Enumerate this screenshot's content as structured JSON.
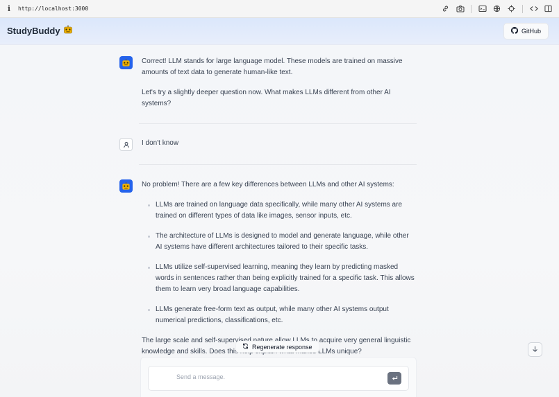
{
  "browser": {
    "info_icon": "i",
    "url": "http://localhost:3000",
    "toolbar_icons": [
      "link-icon",
      "camera-icon",
      "terminal-icon",
      "globe-icon",
      "crosshair-icon",
      "code-icon",
      "sidebar-icon"
    ]
  },
  "header": {
    "brand": "StudyBuddy",
    "brand_icon": "robot-emoji",
    "github_label": "GitHub"
  },
  "messages": [
    {
      "role": "assistant",
      "paragraphs": [
        "Correct! LLM stands for large language model. These models are trained on massive amounts of text data to generate human-like text.",
        "Let's try a slightly deeper question now. What makes LLMs different from other AI systems?"
      ]
    },
    {
      "role": "user",
      "paragraphs": [
        "I don't know"
      ]
    },
    {
      "role": "assistant",
      "intro": "No problem! There are a few key differences between LLMs and other AI systems:",
      "bullets": [
        "LLMs are trained on language data specifically, while many other AI systems are trained on different types of data like images, sensor inputs, etc.",
        "The architecture of LLMs is designed to model and generate language, while other AI systems have different architectures tailored to their specific tasks.",
        "LLMs utilize self-supervised learning, meaning they learn by predicting masked words in sentences rather than being explicitly trained for a specific task. This allows them to learn very broad language capabilities.",
        "LLMs generate free-form text as output, while many other AI systems output numerical predictions, classifications, etc."
      ],
      "outro": "The large scale and self-supervised nature allow LLMs to acquire very general linguistic knowledge and skills. Does this help explain what makes LLMs unique?"
    }
  ],
  "controls": {
    "regenerate_label": "Regenerate response",
    "input_placeholder": "Send a message.",
    "input_value": ""
  },
  "colors": {
    "accent": "#2563eb",
    "header_gradient_top": "#dbe7fb",
    "send_button": "#6b7280"
  }
}
